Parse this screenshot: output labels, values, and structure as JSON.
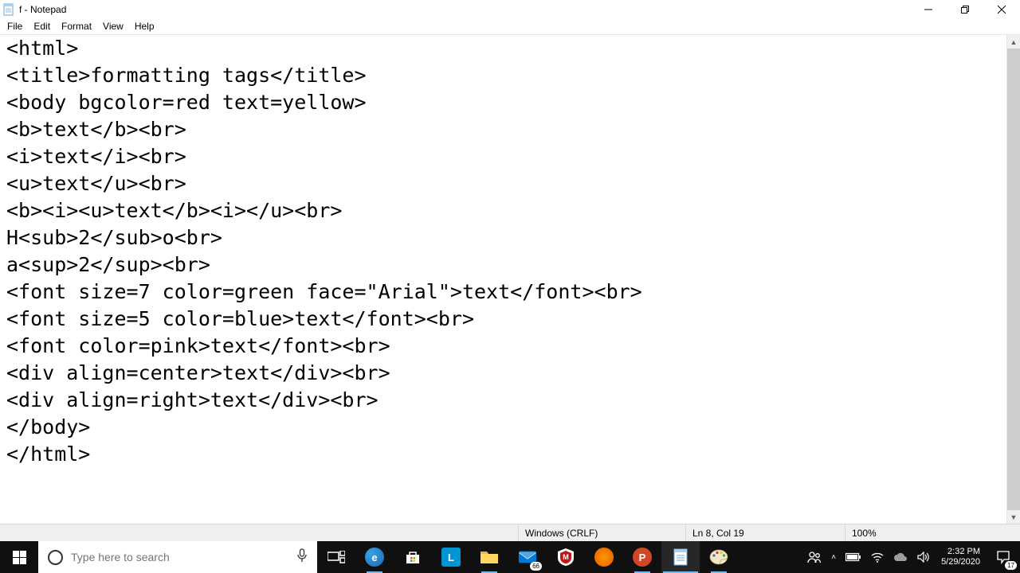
{
  "titlebar": {
    "title": "f - Notepad"
  },
  "menubar": {
    "items": [
      "File",
      "Edit",
      "Format",
      "View",
      "Help"
    ]
  },
  "document": {
    "text": "<html>\n<title>formatting tags</title>\n<body bgcolor=red text=yellow>\n<b>text</b><br>\n<i>text</i><br>\n<u>text</u><br>\n<b><i><u>text</b><i></u><br>\nH<sub>2</sub>o<br>\na<sup>2</sup><br>\n<font size=7 color=green face=\"Arial\">text</font><br>\n<font size=5 color=blue>text</font><br>\n<font color=pink>text</font><br>\n<div align=center>text</div><br>\n<div align=right>text</div><br>\n</body>\n</html>"
  },
  "statusbar": {
    "line_ending": "Windows (CRLF)",
    "cursor": "Ln 8, Col 19",
    "zoom": "100%"
  },
  "taskbar": {
    "search_placeholder": "Type here to search",
    "mail_badge": "66",
    "action_center_badge": "17",
    "clock": {
      "time": "2:32 PM",
      "date": "5/29/2020"
    }
  }
}
